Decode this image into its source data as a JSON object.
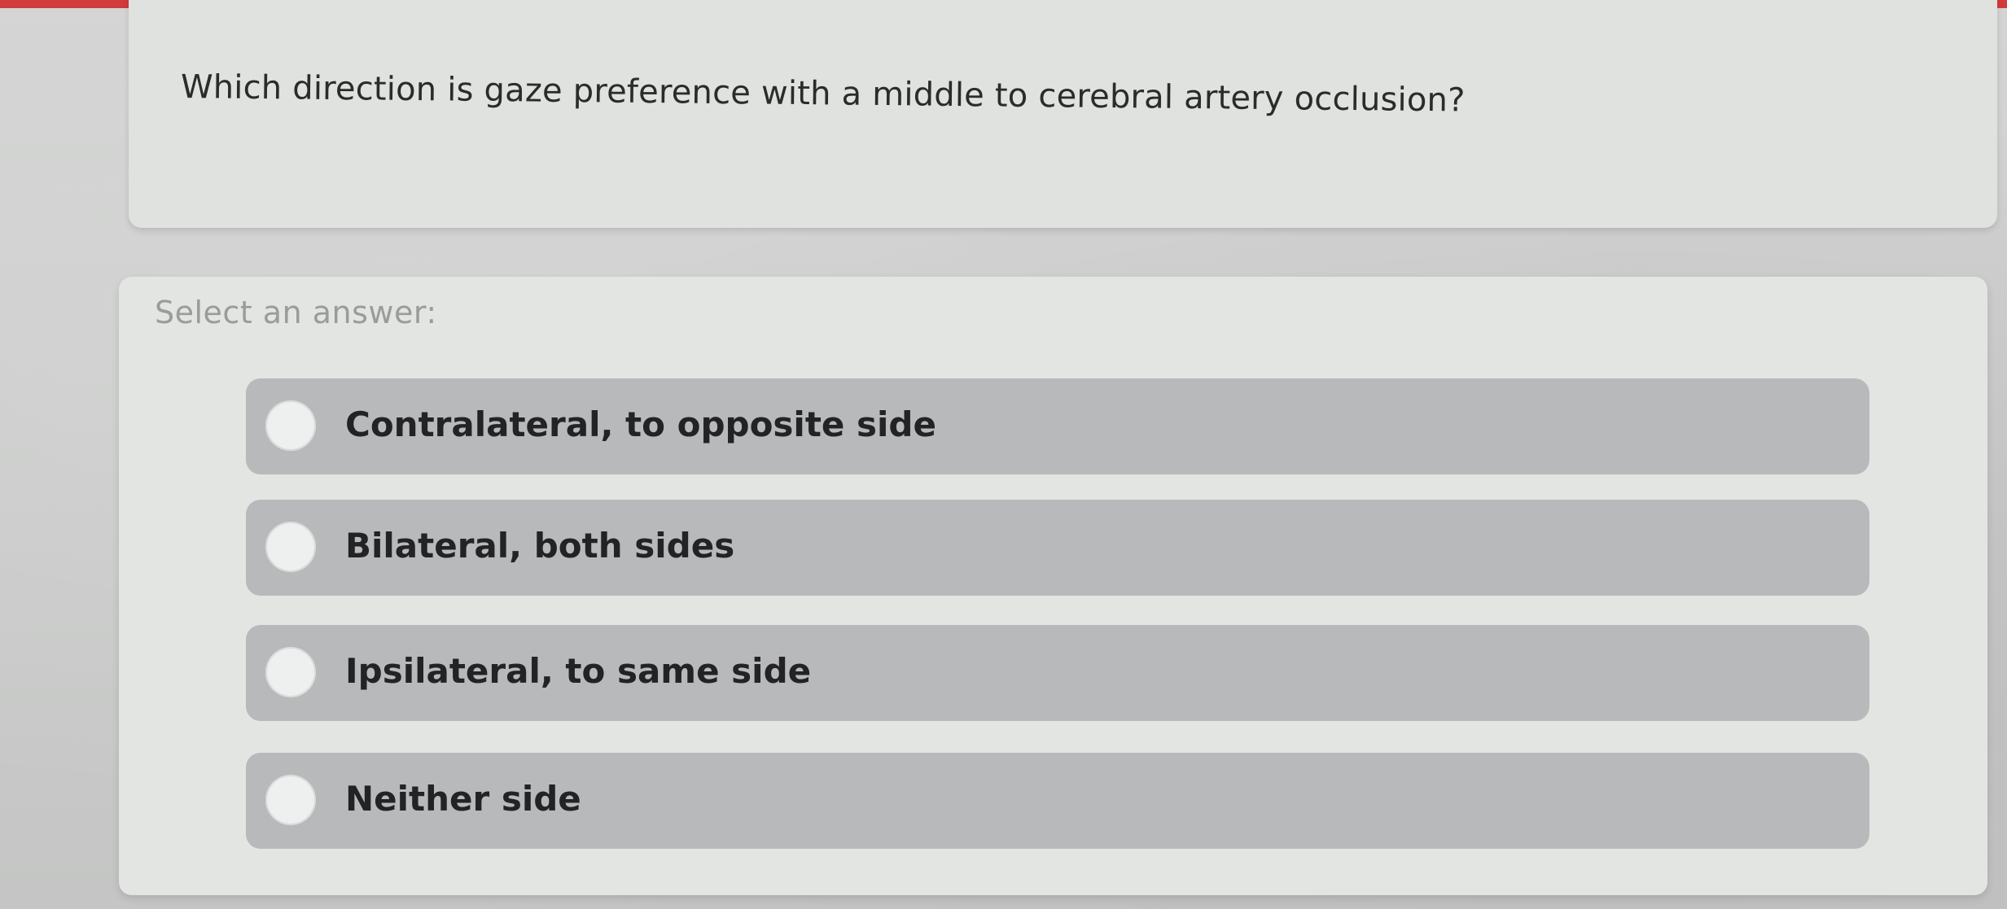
{
  "question": {
    "text": "Which direction is gaze preference with a middle to cerebral artery occlusion?"
  },
  "answers": {
    "prompt": "Select an answer:",
    "options": [
      {
        "label": "Contralateral, to opposite side"
      },
      {
        "label": "Bilateral, both sides"
      },
      {
        "label": "Ipsilateral, to same side"
      },
      {
        "label": "Neither side"
      }
    ]
  },
  "colors": {
    "accent": "#d23b3b",
    "option_background": "#b7b9bb",
    "card_background": "#e3e5e3"
  },
  "icons": {
    "option_selector": "radio-circle-icon"
  }
}
